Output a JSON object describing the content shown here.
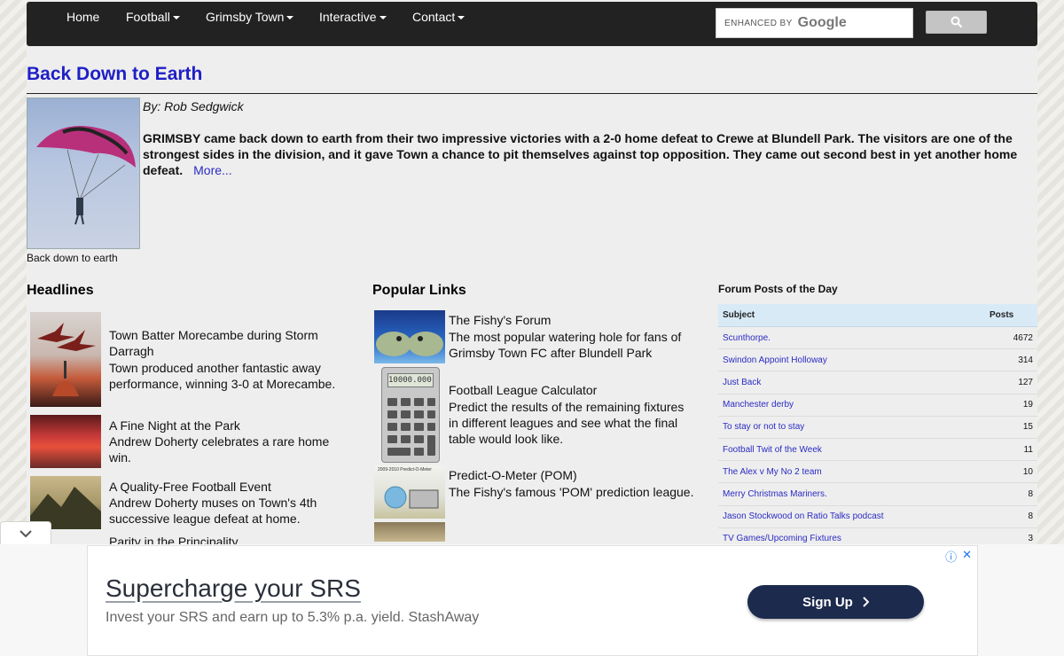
{
  "nav": {
    "items": [
      {
        "label": "Home",
        "dropdown": false
      },
      {
        "label": "Football",
        "dropdown": true
      },
      {
        "label": "Grimsby Town",
        "dropdown": true
      },
      {
        "label": "Interactive",
        "dropdown": true
      },
      {
        "label": "Contact",
        "dropdown": true
      }
    ],
    "search": {
      "enhanced_label": "ENHANCED BY",
      "brand": "Google",
      "button_icon": "search-icon"
    }
  },
  "article": {
    "title": "Back Down to Earth",
    "byline": "By: Rob Sedgwick",
    "lead": "GRIMSBY came back down to earth from their two impressive victories with a 2-0 home defeat to Crewe at Blundell Park. The visitors are one of the strongest sides in the division, and it gave Town a chance to pit themselves against top opposition. They came out second best in yet another home defeat.",
    "more": "More...",
    "caption": "Back down to earth"
  },
  "headlines": {
    "title": "Headlines",
    "items": [
      {
        "title": "Town Batter Morecambe during Storm Darragh",
        "desc": "Town produced another fantastic away performance, winning 3-0 at Morecambe."
      },
      {
        "title": "A Fine Night at the Park",
        "desc": "Andrew Doherty celebrates a rare home win."
      },
      {
        "title": "A Quality-Free Football Event",
        "desc": "Andrew Doherty muses on Town's 4th successive league defeat at home."
      },
      {
        "title": "Parity in the Principality",
        "desc": ""
      }
    ]
  },
  "popular": {
    "title": "Popular Links",
    "items": [
      {
        "title": "The Fishy's Forum",
        "desc": "The most popular watering hole for fans of Grimsby Town FC after Blundell Park"
      },
      {
        "title": "Football League Calculator",
        "desc": "Predict the results of the remaining fixtures in different leagues and see what the final table would look like."
      },
      {
        "title": "Predict-O-Meter (POM)",
        "desc": "The Fishy's famous 'POM' prediction league."
      }
    ],
    "calc_display": "10000.000",
    "pom_label": "2009-2010  Predict-O-Meter"
  },
  "forum": {
    "title": "Forum Posts of the Day",
    "col_subject": "Subject",
    "col_posts": "Posts",
    "rows": [
      {
        "subject": "Scunthorpe.",
        "posts": "4672"
      },
      {
        "subject": "Swindon  Appoint Holloway",
        "posts": "314"
      },
      {
        "subject": "Just Back",
        "posts": "127"
      },
      {
        "subject": "Manchester derby",
        "posts": "19"
      },
      {
        "subject": "To stay or not to stay",
        "posts": "15"
      },
      {
        "subject": "Football Twit of the Week",
        "posts": "11"
      },
      {
        "subject": "The Alex v My No 2 team",
        "posts": "10"
      },
      {
        "subject": "Merry Christmas Mariners.",
        "posts": "8"
      },
      {
        "subject": "Jason Stockwood on Ratio Talks podcast",
        "posts": "8"
      },
      {
        "subject": "TV Games/Upcoming Fixtures",
        "posts": "3"
      }
    ]
  },
  "ad": {
    "headline": "Supercharge your SRS",
    "body": "Invest your SRS and earn up to 5.3% p.a. yield. StashAway",
    "button": "Sign Up"
  },
  "colors": {
    "nav_bg": "#222222",
    "link": "#2b2bc4",
    "title": "#1f1fc6",
    "forum_head": "#d9eaf7",
    "ad_button": "#1c2a4d"
  }
}
